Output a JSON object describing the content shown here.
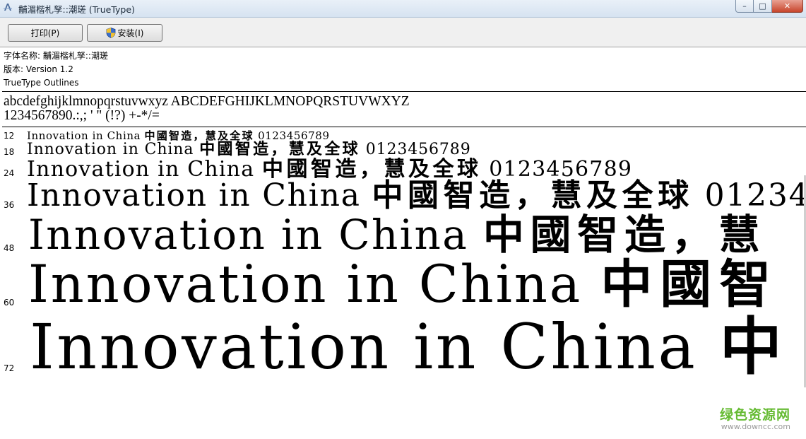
{
  "window": {
    "title": "黼湄楷札孥::潮瑳 (TrueType)",
    "icon": "font-viewer-icon",
    "controls": {
      "minimize": "–",
      "maximize": "□",
      "close": "✕"
    }
  },
  "toolbar": {
    "print_label": "打印(P)",
    "install_label": "安装(I)",
    "install_icon": "uac-shield-icon"
  },
  "info": {
    "font_name_line": "字体名称: 黼湄楷札孥::潮瑳",
    "version_line": "版本: Version 1.2",
    "outline_line": "TrueType Outlines"
  },
  "charset": {
    "line1": "abcdefghijklmnopqrstuvwxyz ABCDEFGHIJKLMNOPQRSTUVWXYZ",
    "line2": "1234567890.:,; ' \" (!?) +-*/="
  },
  "samples": [
    {
      "size": "12",
      "latin": "Innovation in China ",
      "cjk": "中國智造，慧及全球",
      "digits": " 0123456789"
    },
    {
      "size": "18",
      "latin": "Innovation in China ",
      "cjk": "中國智造，慧及全球",
      "digits": " 0123456789"
    },
    {
      "size": "24",
      "latin": "Innovation in China ",
      "cjk": "中國智造，慧及全球",
      "digits": " 0123456789"
    },
    {
      "size": "36",
      "latin": "Innovation in China ",
      "cjk": "中國智造，慧及全球",
      "digits": " 01234"
    },
    {
      "size": "48",
      "latin": "Innovation in China ",
      "cjk": "中國智造，慧",
      "digits": ""
    },
    {
      "size": "60",
      "latin": "Innovation in China ",
      "cjk": "中國智",
      "digits": ""
    },
    {
      "size": "72",
      "latin": "Innovation in China ",
      "cjk": "中",
      "digits": ""
    }
  ],
  "watermark": {
    "name": "绿色资源网",
    "url": "www.downcc.com"
  }
}
